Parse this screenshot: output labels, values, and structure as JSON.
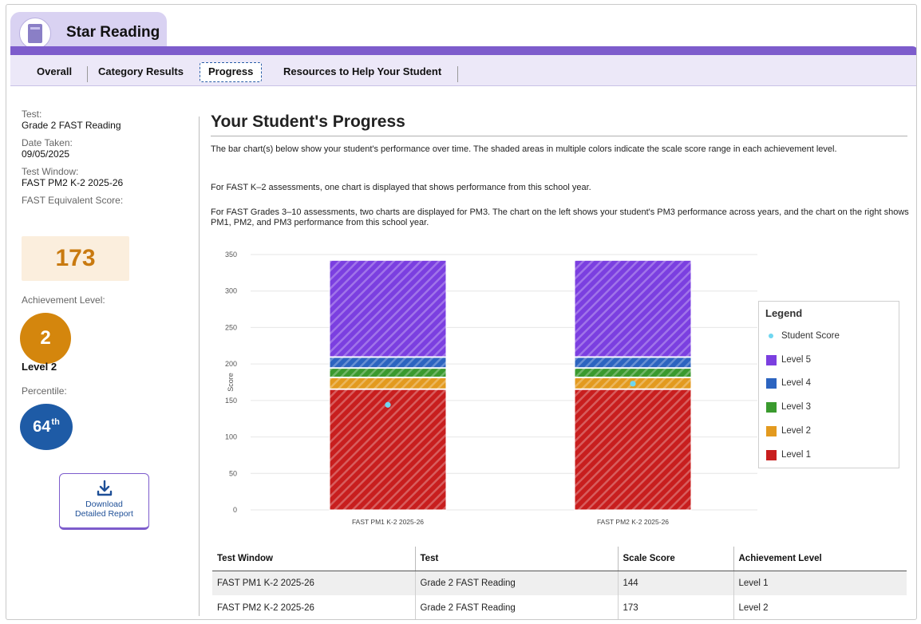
{
  "app": {
    "title": "Star Reading",
    "logo_icon": "book-icon"
  },
  "nav": {
    "tabs": [
      "Overall",
      "Category Results",
      "Progress",
      "Resources to Help Your Student"
    ],
    "active": "Progress"
  },
  "left": {
    "test_label": "Test:",
    "test_value": "Grade 2 FAST Reading",
    "date_label": "Date Taken:",
    "date_value": "09/05/2025",
    "window_label": "Test Window:",
    "window_value": "FAST PM2 K-2 2025-26",
    "equiv_label": "FAST Equivalent Score:",
    "equiv_value": "173",
    "ach_label": "Achievement Level:",
    "ach_number": "2",
    "ach_name": "Level 2",
    "pct_label": "Percentile:",
    "pct_value": "64",
    "pct_suffix": "th",
    "download_line1": "Download",
    "download_line2": "Detailed Report"
  },
  "main": {
    "title": "Your Student's Progress",
    "p1": "The bar chart(s) below show your student's performance over time. The shaded areas in multiple colors indicate the scale score range in each achievement level.",
    "p2": "For FAST K–2 assessments, one chart is displayed that shows performance from this school year.",
    "p3": "For FAST Grades 3–10 assessments, two charts are displayed for PM3. The chart on the left shows your student's PM3 performance across years, and the chart on the right shows PM1, PM2, and PM3 performance from this school year."
  },
  "chart_data": {
    "type": "bar",
    "ylabel": "Score",
    "ylim": [
      0,
      350
    ],
    "yticks": [
      0,
      50,
      100,
      150,
      200,
      250,
      300,
      350
    ],
    "categories": [
      "FAST PM1 K-2 2025-26",
      "FAST PM2 K-2 2025-26"
    ],
    "levels": [
      {
        "name": "Level 1",
        "from": 0,
        "to": 165,
        "color": "#c81e1e"
      },
      {
        "name": "Level 2",
        "from": 166,
        "to": 181,
        "color": "#e39a1f"
      },
      {
        "name": "Level 3",
        "from": 182,
        "to": 194,
        "color": "#3a9a2e"
      },
      {
        "name": "Level 4",
        "from": 195,
        "to": 209,
        "color": "#2c64c0"
      },
      {
        "name": "Level 5",
        "from": 210,
        "to": 342,
        "color": "#7b3fe0"
      }
    ],
    "student_scores": [
      144,
      173
    ],
    "legend_title": "Legend",
    "legend_student": "Student Score",
    "student_color": "#6fd6f0"
  },
  "table": {
    "headers": [
      "Test Window",
      "Test",
      "Scale Score",
      "Achievement Level"
    ],
    "rows": [
      [
        "FAST PM1 K-2 2025-26",
        "Grade 2 FAST Reading",
        "144",
        "Level 1"
      ],
      [
        "FAST PM2 K-2 2025-26",
        "Grade 2 FAST Reading",
        "173",
        "Level 2"
      ]
    ]
  }
}
